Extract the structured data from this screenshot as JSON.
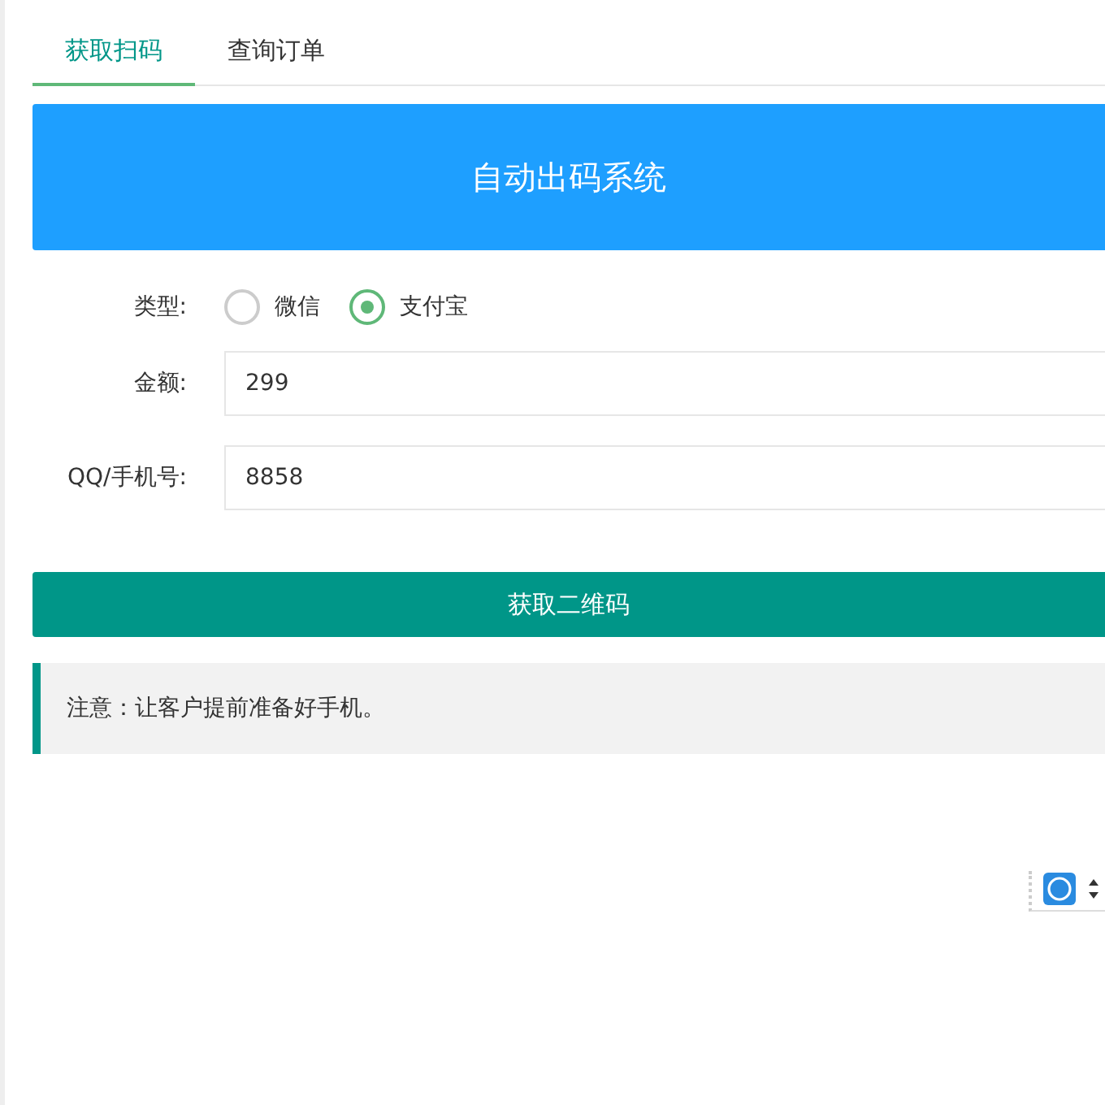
{
  "tabs": [
    {
      "label": "获取扫码",
      "selected": true
    },
    {
      "label": "查询订单",
      "selected": false
    }
  ],
  "header": {
    "title": "自动出码系统"
  },
  "form": {
    "type": {
      "label": "类型:",
      "options": [
        {
          "label": "微信",
          "selected": false
        },
        {
          "label": "支付宝",
          "selected": true
        }
      ]
    },
    "amount": {
      "label": "金额:",
      "value": "299"
    },
    "contact": {
      "label": "QQ/手机号:",
      "value": "8858"
    }
  },
  "submit": "获取二维码",
  "notice": "注意：让客户提前准备好手机。"
}
